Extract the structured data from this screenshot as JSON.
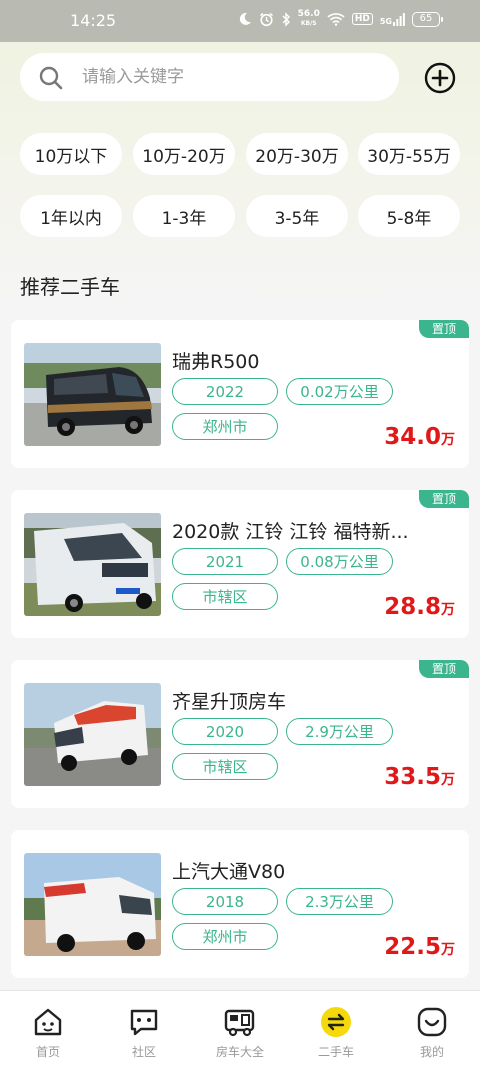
{
  "status_bar": {
    "time": "14:25",
    "net_speed_value": "56.0",
    "net_speed_unit": "KB/S",
    "hd": "HD",
    "signal": "5G",
    "battery": "65"
  },
  "search": {
    "placeholder": "请输入关键字"
  },
  "price_filters": [
    "10万以下",
    "10万-20万",
    "20万-30万",
    "30万-55万"
  ],
  "age_filters": [
    "1年以内",
    "1-3年",
    "3-5年",
    "5-8年"
  ],
  "section_title": "推荐二手车",
  "cars": [
    {
      "title": "瑞弗R500",
      "year": "2022",
      "mileage": "0.02万公里",
      "city": "郑州市",
      "price": "34.0",
      "unit": "万",
      "badge": "置顶"
    },
    {
      "title": "2020款 江铃 江铃 福特新...",
      "year": "2021",
      "mileage": "0.08万公里",
      "city": "市辖区",
      "price": "28.8",
      "unit": "万",
      "badge": "置顶"
    },
    {
      "title": "齐星升顶房车",
      "year": "2020",
      "mileage": "2.9万公里",
      "city": "市辖区",
      "price": "33.5",
      "unit": "万",
      "badge": "置顶"
    },
    {
      "title": "上汽大通V80",
      "year": "2018",
      "mileage": "2.3万公里",
      "city": "郑州市",
      "price": "22.5",
      "unit": "万"
    }
  ],
  "nav": [
    {
      "label": "首页",
      "icon": "home-icon"
    },
    {
      "label": "社区",
      "icon": "chat-icon"
    },
    {
      "label": "房车大全",
      "icon": "rv-icon"
    },
    {
      "label": "二手车",
      "icon": "exchange-icon",
      "active": true
    },
    {
      "label": "我的",
      "icon": "profile-icon"
    }
  ],
  "colors": {
    "accent": "#3bb58e",
    "price": "#e01818",
    "active_nav": "#f5d90a"
  }
}
